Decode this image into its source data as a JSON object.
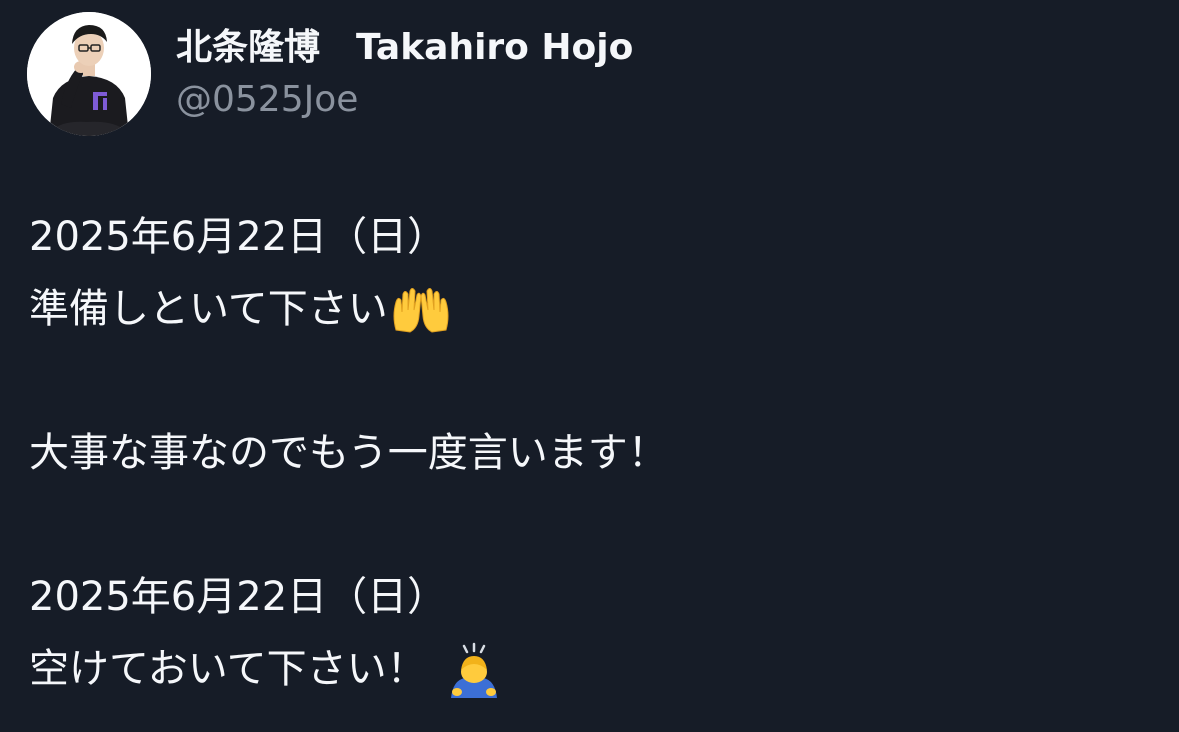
{
  "author": {
    "display_name": "北条隆博　Takahiro Hojo",
    "handle": "@0525Joe"
  },
  "post": {
    "lines": [
      "2025年6月22日（日）",
      "準備しといて下さい",
      "大事な事なのでもう一度言います！",
      "2025年6月22日（日）",
      "空けておいて下さい！"
    ],
    "emojis": [
      "palms-up-together-icon",
      "person-bowing-icon"
    ]
  },
  "colors": {
    "background": "#161c27",
    "text": "#f5f7fa",
    "handle": "#8a929e"
  }
}
